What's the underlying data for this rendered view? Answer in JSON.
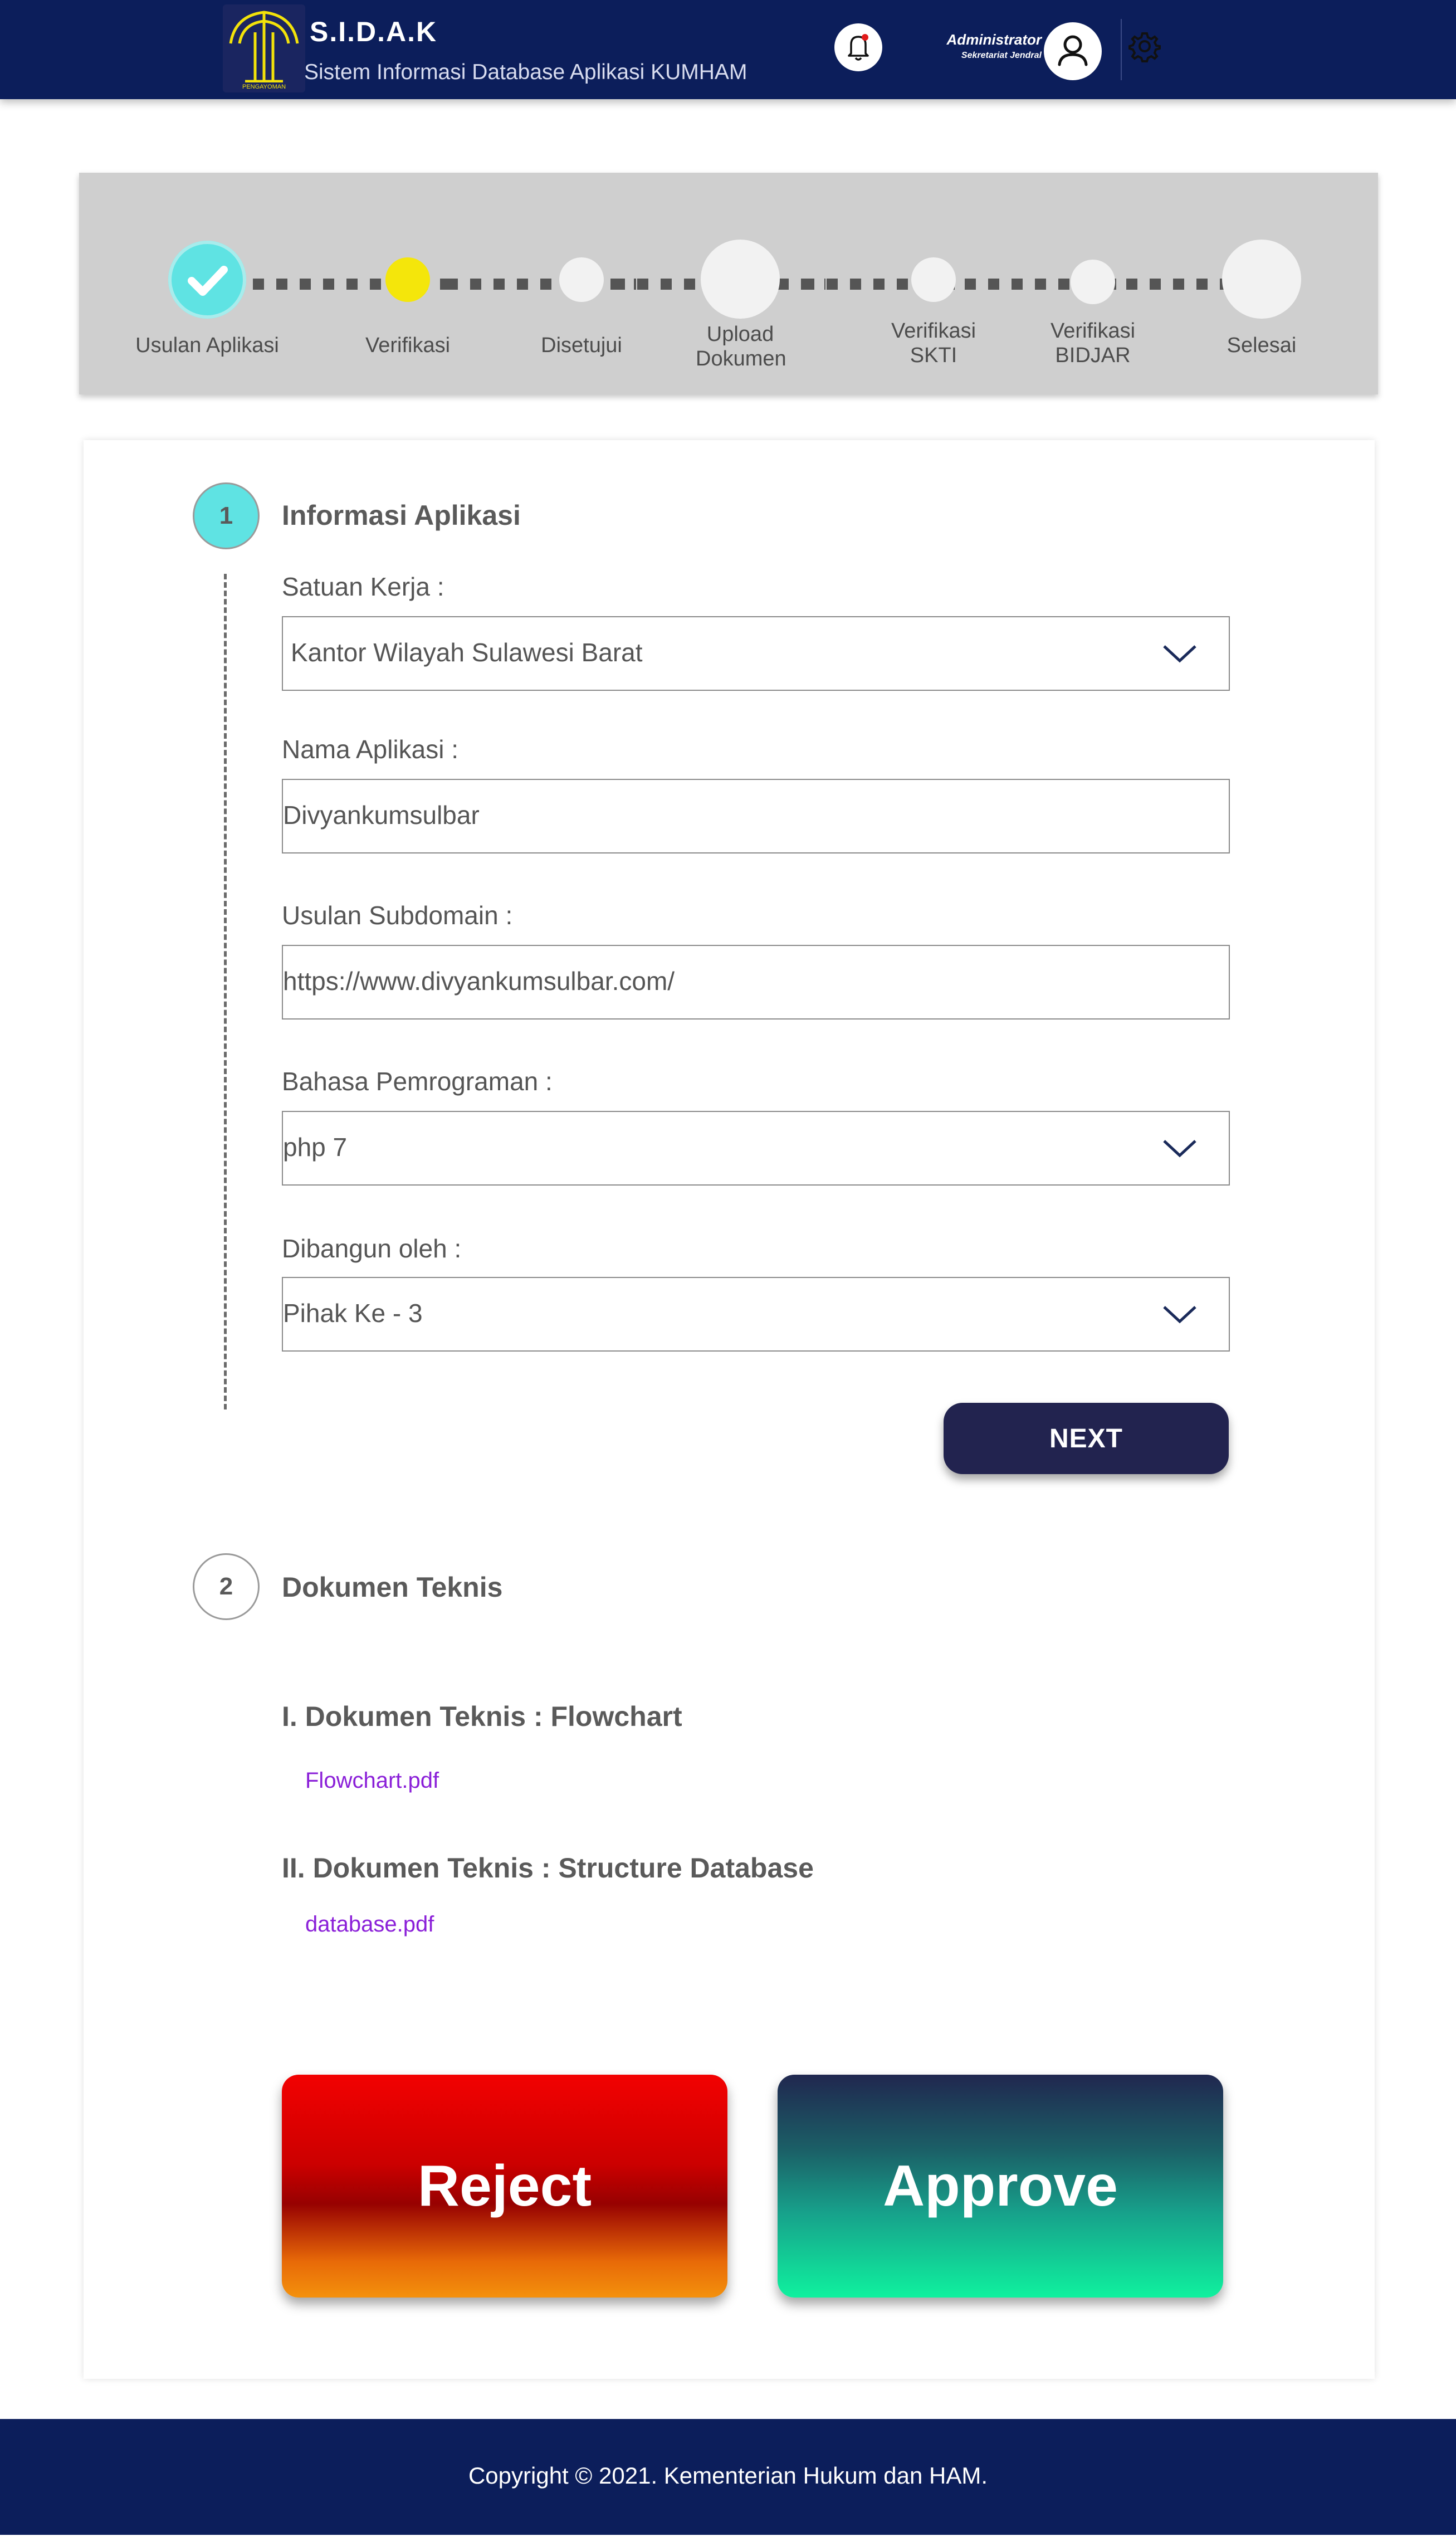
{
  "header": {
    "brand_title": "S.I.D.A.K",
    "brand_subtitle": "Sistem Informasi Database Aplikasi KUMHAM",
    "logo_text": "PENGAYOMAN",
    "user_name": "Administrator",
    "user_role": "Sekretariat Jendral"
  },
  "stepper": {
    "steps": [
      {
        "label": "Usulan Aplikasi",
        "status": "done"
      },
      {
        "label": "Verifikasi",
        "status": "current"
      },
      {
        "label": "Disetujui",
        "status": "pending"
      },
      {
        "label": "Upload Dokumen",
        "status": "pending"
      },
      {
        "label": "Verifikasi SKTI",
        "status": "pending"
      },
      {
        "label": "Verifikasi BIDJAR",
        "status": "pending"
      },
      {
        "label": "Selesai",
        "status": "pending"
      }
    ]
  },
  "form": {
    "section1": {
      "number": "1",
      "title": "Informasi Aplikasi"
    },
    "fields": [
      {
        "label": "Satuan Kerja :",
        "value": "Kantor Wilayah Sulawesi Barat",
        "type": "select"
      },
      {
        "label": "Nama Aplikasi :",
        "value": "Divyankumsulbar",
        "type": "text"
      },
      {
        "label": "Usulan Subdomain :",
        "value": "https://www.divyankumsulbar.com/",
        "type": "text"
      },
      {
        "label": "Bahasa Pemrograman :",
        "value": "php 7",
        "type": "select"
      },
      {
        "label": "Dibangun oleh :",
        "value": "Pihak Ke - 3",
        "type": "select"
      }
    ],
    "next_label": "NEXT",
    "section2": {
      "number": "2",
      "title": "Dokumen Teknis"
    },
    "documents": [
      {
        "title": "I. Dokumen Teknis : Flowchart",
        "file": "Flowchart.pdf"
      },
      {
        "title": "II. Dokumen Teknis : Structure Database",
        "file": "database.pdf"
      }
    ]
  },
  "actions": {
    "reject_label": "Reject",
    "approve_label": "Approve"
  },
  "footer": {
    "copyright": "Copyright © 2021. Kementerian Hukum dan HAM."
  },
  "colors": {
    "header_bg": "#0c1e5b",
    "stepper_bg": "#cfcfcf",
    "step_done": "#5fe3e3",
    "step_current": "#f4e60b",
    "next_button": "#22234f",
    "link": "#8a1fd8"
  },
  "icons": [
    "logo-emblem",
    "bell-icon",
    "user-icon",
    "gear-icon",
    "check-icon",
    "chevron-down-icon"
  ]
}
